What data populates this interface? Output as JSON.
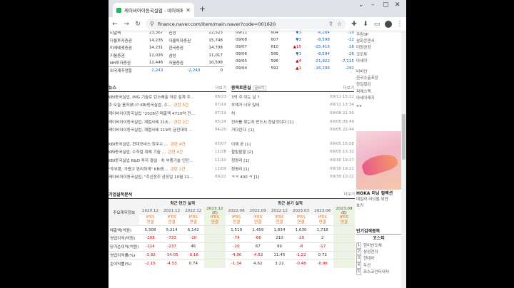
{
  "browser": {
    "tab_title": "케이비아이동국실업 : 네이버페이",
    "url": "finance.naver.com/item/main.naver?code=001620"
  },
  "investors": {
    "rows": [
      {
        "name": "티알텍",
        "v1": "23,367",
        "broker": "신정",
        "v2": "22,523"
      },
      {
        "name": "다올투자증권",
        "v1": "14,235",
        "broker": "다올투자증권",
        "v2": "15,748"
      },
      {
        "name": "미래에셋증권",
        "v1": "14,231",
        "broker": "한국증권",
        "v2": "14,708"
      },
      {
        "name": "키움증권",
        "v1": "12,026",
        "broker": "삼성",
        "v2": "11,017"
      },
      {
        "name": "NH투자증권",
        "v1": "12,446",
        "broker": "키움증권",
        "v2": "10,598"
      }
    ],
    "foreign": {
      "name": "외국계추정합",
      "v1": "2,243",
      "v2": "-2,243",
      "v3": "0"
    }
  },
  "trades": {
    "rows": [
      {
        "date": "09/11",
        "price": "604",
        "dir": "down",
        "chg": "3",
        "pct": "-6,284",
        "vol": "-10"
      },
      {
        "date": "09/08",
        "price": "607",
        "dir": "down",
        "chg": "3",
        "pct": "-8,598",
        "vol": "-12"
      },
      {
        "date": "09/07",
        "price": "610",
        "dir": "up",
        "chg": "15",
        "pct": "-25,415",
        "vol": "-18"
      },
      {
        "date": "09/06",
        "price": "595",
        "dir": "down",
        "chg": "1",
        "pct": "-8,594",
        "vol": "-26"
      },
      {
        "date": "09/05",
        "price": "596",
        "dir": "up",
        "chg": "4",
        "pct": "-21,922",
        "vol": "-7,115"
      },
      {
        "date": "09/04",
        "price": "592",
        "dir": "up",
        "chg": "1",
        "pct": "-16,196",
        "vol": "-242"
      }
    ]
  },
  "news": {
    "title": "뉴스",
    "more": "더보기",
    "items": [
      {
        "text": "KBI동국실업, IMG 기술로 탄소배출 저감 설계 주…",
        "rel": "",
        "date": "08/23"
      },
      {
        "text": "주 오늘 움직였나? KBI동국실업, 수…",
        "rel": "관련 5건",
        "date": "07/19"
      },
      {
        "text": "케이비아이동국실업 \"2026년 매출액 4710억 전…",
        "rel": "",
        "date": "07/19"
      },
      {
        "text": "케이비아이동국실업, 계열사에 118…",
        "rel": "관련 2건",
        "date": "05/24"
      },
      {
        "text": "케이비아이동국실업, 계열사에 119억 금전대여 …",
        "rel": "",
        "date": "04/20"
      },
      {
        "text": "KBI동국실업, 현대모비스 최우수 …",
        "rel": "관련 4건",
        "date": "03/07"
      },
      {
        "text": "KBI동국실업, 수직얼 대체 기술 …",
        "rel": "관련 4건",
        "date": "11/28"
      },
      {
        "text": "KBI동국실업 R&D 투자 결실 · 차 부품기술 인탄…",
        "rel": "",
        "date": "11/10"
      },
      {
        "text": "\"투부품, 가볍고 편리하게\" KBI동…",
        "rel": "관련 2건",
        "date": "11/09"
      },
      {
        "text": "케이비아이동국실업, \"주선정주 상장일 10월 11…",
        "rel": "",
        "date": "09/22"
      }
    ]
  },
  "board": {
    "title": "종목토론실",
    "badge": "글쓰기",
    "more": "더보기",
    "items": [
      {
        "text": "3억 주 이는 날 ?",
        "date": "09/11 15:12"
      },
      {
        "text": "부채가 너무 많네",
        "date": "09/11 13:34"
      },
      {
        "text": "허",
        "date": "09/08 21:30"
      },
      {
        "text": "전라를 찾는자 반드시 한날것이다 [1]",
        "date": "09/05 09:49"
      },
      {
        "text": "거다린다. [1]",
        "date": "09/05 22:44"
      },
      {
        "text": "이제 곧 [1]",
        "date": "09/05 16:58"
      },
      {
        "text": "할말할말 [2]",
        "date": "09/05 13:32"
      },
      {
        "text": "청평리 [1]",
        "date": "09/30 19:17"
      },
      {
        "text": "청평리 [1]",
        "date": "09/30 19:22"
      },
      {
        "text": "ㅋㅋ 400 ㅋ [1]",
        "date": "09/30 10:22"
      }
    ]
  },
  "finance": {
    "title": "기업실적분석",
    "more": "더보기",
    "row_header": "주요재무정보",
    "annual_label": "최근 연간 실적",
    "quarter_label": "최근 분기 실적",
    "annual_cols": [
      "2020.12",
      "2021.12",
      "2022.12",
      "2023.12\n(E)"
    ],
    "quarter_cols": [
      "2022.06",
      "2022.09",
      "2022.12",
      "2023.03",
      "2023.06",
      "2023.09\n(E)"
    ],
    "ifrs": "IFRS\n연결",
    "rows": [
      {
        "label": "매출액(억원)",
        "a": [
          "5,308",
          "5,214",
          "6,142",
          ""
        ],
        "q": [
          "1,519",
          "1,459",
          "1,834",
          "1,630",
          "1,718",
          ""
        ]
      },
      {
        "label": "영업이익(억원)",
        "a": [
          "-208",
          "-733",
          "-10",
          ""
        ],
        "q": [
          "-74",
          "-66",
          "210",
          "-20",
          "2",
          ""
        ]
      },
      {
        "label": "당기순이익(억원)",
        "a": [
          "-114",
          "-237",
          "46",
          ""
        ],
        "q": [
          "-20",
          "67",
          "99",
          "-8",
          "-17",
          ""
        ]
      },
      {
        "label": "영업이익률(%)",
        "a": [
          "-3.92",
          "-14.05",
          "-0.16",
          ""
        ],
        "q": [
          "-4.90",
          "-4.52",
          "11.45",
          "-1.22",
          "0.72",
          ""
        ]
      },
      {
        "label": "순이익률(%)",
        "a": [
          "-2.15",
          "-4.53",
          "0.74",
          ""
        ],
        "q": [
          "-1.34",
          "4.62",
          "3.22",
          "-0.48",
          "-0.96",
          ""
        ]
      }
    ]
  },
  "right": {
    "top": [
      "주림SP",
      "삼화콘덴서",
      "미원공장",
      "코모류",
      "아세아"
    ],
    "mid": [
      "비비안",
      "한국수출포장",
      "한일철강",
      "피에스텍",
      "아세아제지"
    ],
    "ad": {
      "brand": "HOKA 러닝 컬렉션",
      "line2": "데일리 러닝을 위한",
      "line3": "호카"
    },
    "popular_title": "인기검색종목",
    "popular_tab": "코스피",
    "popular": [
      {
        "n": "1",
        "name": "한미반도체"
      },
      {
        "n": "2",
        "name": "삼성전자"
      },
      {
        "n": "3",
        "name": "현대차"
      },
      {
        "n": "4",
        "name": "두산"
      },
      {
        "n": "5",
        "name": "포스코인터내셔"
      }
    ]
  }
}
